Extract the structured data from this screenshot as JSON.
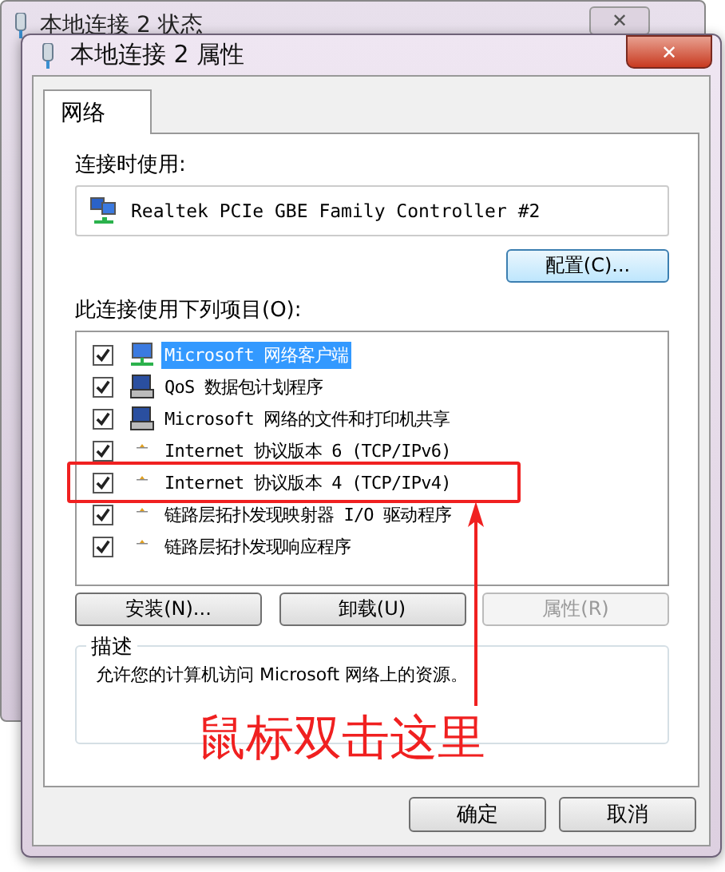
{
  "background_window": {
    "title": "本地连接 2 状态",
    "close_button": "✕"
  },
  "window": {
    "title": "本地连接 2 属性",
    "close_button": "✕"
  },
  "tabs": [
    {
      "label": "网络",
      "selected": true
    }
  ],
  "connect_using": {
    "label": "连接时使用:",
    "adapter": "Realtek PCIe GBE Family Controller #2",
    "configure_button": "配置(C)..."
  },
  "items_label": "此连接使用下列项目(O):",
  "items": [
    {
      "label": "Microsoft 网络客户端",
      "kind": "client",
      "checked": true,
      "selected": true,
      "highlighted": false
    },
    {
      "label": "QoS 数据包计划程序",
      "kind": "service",
      "checked": true,
      "selected": false,
      "highlighted": false
    },
    {
      "label": "Microsoft 网络的文件和打印机共享",
      "kind": "service",
      "checked": true,
      "selected": false,
      "highlighted": false
    },
    {
      "label": "Internet 协议版本 6 (TCP/IPv6)",
      "kind": "protocol",
      "checked": true,
      "selected": false,
      "highlighted": false
    },
    {
      "label": "Internet 协议版本 4 (TCP/IPv4)",
      "kind": "protocol",
      "checked": true,
      "selected": false,
      "highlighted": true
    },
    {
      "label": "链路层拓扑发现映射器 I/O 驱动程序",
      "kind": "protocol",
      "checked": true,
      "selected": false,
      "highlighted": false
    },
    {
      "label": "链路层拓扑发现响应程序",
      "kind": "protocol",
      "checked": true,
      "selected": false,
      "highlighted": false
    }
  ],
  "item_buttons": [
    {
      "label": "安装(N)...",
      "disabled": false
    },
    {
      "label": "卸载(U)",
      "disabled": false
    },
    {
      "label": "属性(R)",
      "disabled": true
    }
  ],
  "description": {
    "legend": "描述",
    "text": "允许您的计算机访问 Microsoft 网络上的资源。"
  },
  "annotation": {
    "text": "鼠标双击这里"
  },
  "buttons": [
    "确定",
    "取消"
  ]
}
